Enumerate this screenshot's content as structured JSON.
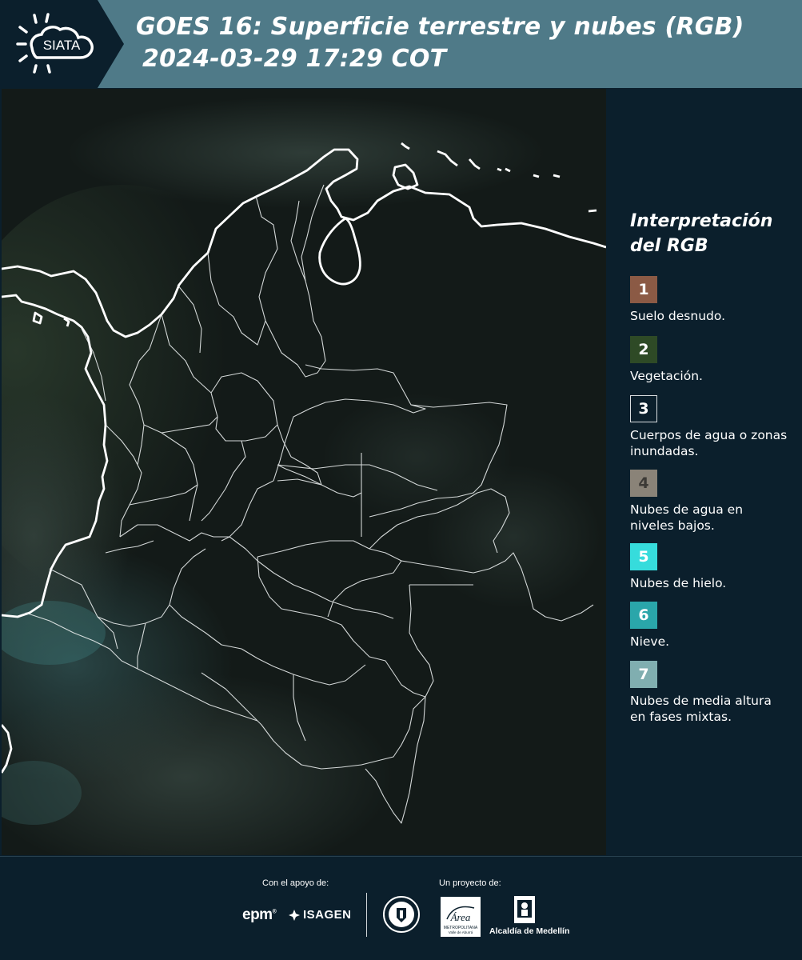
{
  "header": {
    "logo_text": "SIATA",
    "title_line1": "GOES 16: Superficie terrestre y nubes (RGB)",
    "title_line2": "2024-03-29 17:29 COT"
  },
  "map": {
    "background_color": "#131a18",
    "border_color": "#ffffff"
  },
  "legend": {
    "title_line1": "Interpretación",
    "title_line2": "del RGB",
    "items": [
      {
        "number": "1",
        "label": "Suelo desnudo.",
        "color": "#8b5a45"
      },
      {
        "number": "2",
        "label": "Vegetación.",
        "color": "#2e4a26"
      },
      {
        "number": "3",
        "label": "Cuerpos de agua o zonas inundadas.",
        "color": "#0b1f2c"
      },
      {
        "number": "4",
        "label": "Nubes de agua en niveles bajos.",
        "color": "#8a8378"
      },
      {
        "number": "5",
        "label": "Nubes de hielo.",
        "color": "#36dcdc"
      },
      {
        "number": "6",
        "label": "Nieve.",
        "color": "#2aa6aa"
      },
      {
        "number": "7",
        "label": "Nubes de media altura en fases mixtas.",
        "color": "#80aeb0"
      }
    ]
  },
  "footer": {
    "support_label": "Con el apoyo de:",
    "project_label": "Un proyecto de:",
    "epm_text": "epm",
    "isagen_text": "ISAGEN",
    "area_text": "Área",
    "area_sub1": "METROPOLITANA",
    "area_sub2": "Valle de Aburrá",
    "alcaldia_text": "Alcaldía de Medellín"
  }
}
